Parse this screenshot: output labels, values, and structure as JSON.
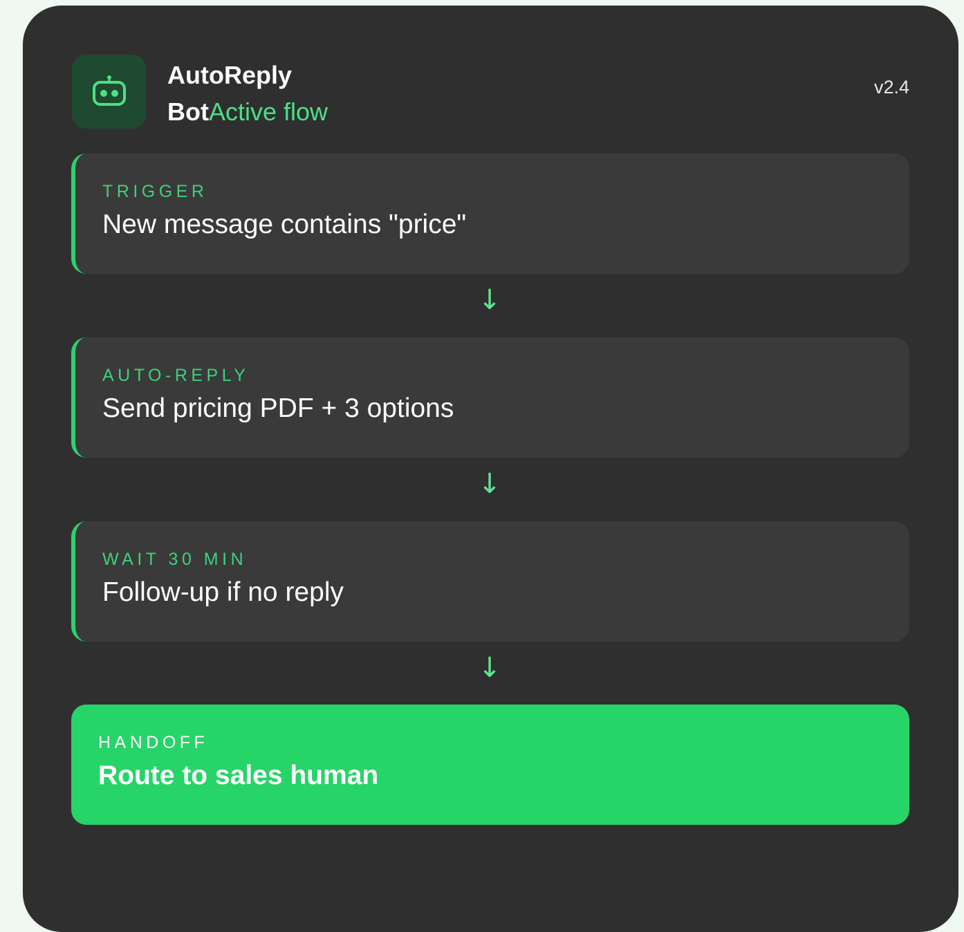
{
  "header": {
    "title": "AutoReply",
    "subtitle_strong": "Bot",
    "subtitle_accent": "Active flow",
    "version": "v2.4",
    "logo_icon": "robot-icon"
  },
  "colors": {
    "accent": "#2ed16b",
    "accent_text": "#4ce084",
    "card_bg": "#2f2f2f",
    "step_bg": "#3a3a3a",
    "final_bg": "#27d468",
    "logo_bg": "#1e4a30"
  },
  "steps": [
    {
      "label": "TRIGGER",
      "text": "New message contains \"price\""
    },
    {
      "label": "AUTO-REPLY",
      "text": "Send pricing PDF + 3 options"
    },
    {
      "label": "WAIT 30 MIN",
      "text": "Follow-up if no reply"
    }
  ],
  "arrow_glyph": "↓",
  "final": {
    "label": "HANDOFF",
    "text": "Route to sales human"
  }
}
